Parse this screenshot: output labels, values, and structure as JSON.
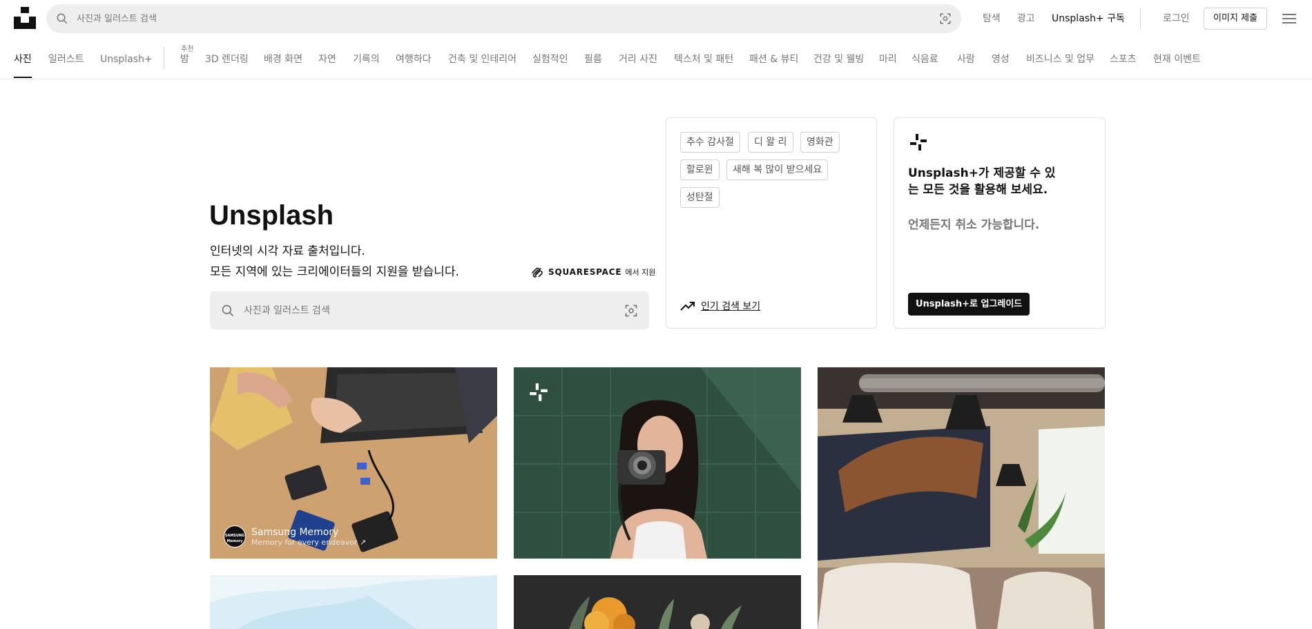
{
  "header": {
    "search_placeholder": "사진과 일러스트 검색",
    "nav": {
      "explore": "탐색",
      "ads": "광고",
      "subscribe": "Unsplash+ 구독"
    },
    "login": "로그인",
    "submit_image": "이미지 제출"
  },
  "categories": {
    "active": "사진",
    "illustrations": "일러스트",
    "unsplash_plus": "Unsplash+",
    "featured_label": "추천",
    "items": [
      "밤",
      "3D 렌더링",
      "배경 화면",
      "자연",
      "기록의",
      "여행하다",
      "건축 및 인테리어",
      "실험적인",
      "필름",
      "거리 사진",
      "텍스처 및 패턴",
      "패션 & 뷰티",
      "건강 및 웰빙",
      "마리",
      "식음료",
      "사람",
      "영성",
      "비즈니스 및 업무",
      "스포츠",
      "현재 이벤트"
    ]
  },
  "hero": {
    "title": "Unsplash",
    "line1": "인터넷의 시각 자료 출처입니다.",
    "line2": "모든 지역에 있는 크리에이터들의 지원을 받습니다.",
    "sponsor_name": "SQUARESPACE",
    "sponsor_suffix": "에서 지원",
    "search_placeholder": "사진과 일러스트 검색"
  },
  "trending": {
    "tags": [
      "추수 감사절",
      "디 왈 리",
      "영화관",
      "할로윈",
      "새해 복 많이 받으세요",
      "성탄절"
    ],
    "link": "인기 검색 보기"
  },
  "plus_card": {
    "headline": "Unsplash+가 제공할 수 있는 모든 것을 활용해 보세요.",
    "sub": "언제든지 취소 가능합니다.",
    "button": "Unsplash+로 업그레이드"
  },
  "photos": {
    "sponsor_name": "Samsung Memory",
    "sponsor_tagline": "Memory for every endeavor ↗",
    "sponsor_avatar": "SAMSUNG Memory"
  },
  "colors": {
    "accent": "#111111",
    "muted": "#767676",
    "search_bg": "#eeeeee",
    "border": "#d1d1d1"
  }
}
